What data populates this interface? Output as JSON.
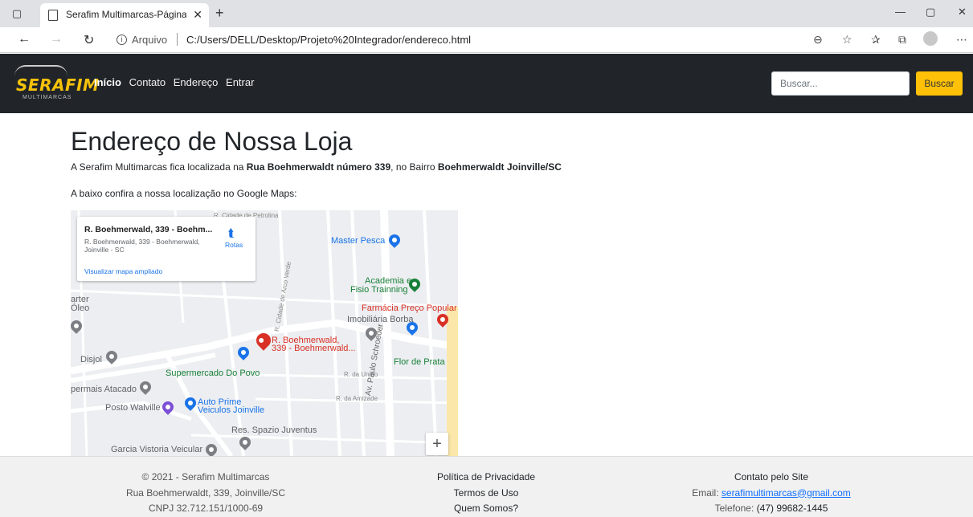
{
  "browser": {
    "tab_title": "Serafim Multimarcas-Página Inici",
    "address_label": "Arquivo",
    "url": "C:/Users/DELL/Desktop/Projeto%20Integrador/endereco.html"
  },
  "navbar": {
    "logo_text": "SERAFIM",
    "logo_subtext": "MULTIMARCAS",
    "links": [
      "Início",
      "Contato",
      "Endereço",
      "Entrar"
    ],
    "search_placeholder": "Buscar...",
    "search_button": "Buscar"
  },
  "main": {
    "title": "Endereço de Nossa Loja",
    "intro_prefix": "A Serafim Multimarcas fica localizada na ",
    "intro_street": "Rua Boehmerwaldt número 339",
    "intro_middle": ", no Bairro ",
    "intro_district": "Boehmerwaldt Joinville/SC",
    "map_intro": "A baixo confira a nossa localização no Google Maps:"
  },
  "map": {
    "card_title": "R. Boehmerwald, 339 - Boehm...",
    "card_address": "R. Boehmerwald, 339 - Boehmerwald, Joinville - SC",
    "card_directions": "Rotas",
    "card_link": "Visualizar mapa ampliado",
    "marker_label_1": "R. Boehmerwald,",
    "marker_label_2": "339 - Boehmerwald...",
    "places": {
      "master_pesca": "Master Pesca",
      "academia_1": "Academia e",
      "academia_2": "Fisio Trainning",
      "farmacia": "Farmácia Preço Popular",
      "imobiliaria": "Imobiliária Borba",
      "flor_prata": "Flor de Prata",
      "supermercado": "Supermercado Do Povo",
      "disjol": "Disjol",
      "atacado": "permais Atacado",
      "auto_prime_1": "Auto Prime",
      "auto_prime_2": "Veiculos Joinville",
      "posto": "Posto Walville",
      "spazio": "Res. Spazio Juventus",
      "garcia": "Garcia Vistoria Veicular",
      "arter_1": "arter",
      "arter_2": "Óleo"
    },
    "streets": {
      "cidade_petrolina": "R. Cidade de Petrolina",
      "da_uniao": "R. da União",
      "da_amizade": "R. da Amizade",
      "paulo_schroeder": "Av. Paulo Schroeder",
      "cidade_arco_verde": "R. Cidade de Arco Verde"
    },
    "zoom_in": "+"
  },
  "footer": {
    "col1": [
      "© 2021 - Serafim Multimarcas",
      "Rua Boehmerwaldt, 339, Joinville/SC",
      "CNPJ 32.712.151/1000-69"
    ],
    "col2": [
      "Política de Privacidade",
      "Termos de Uso",
      "Quem Somos?"
    ],
    "col3_title": "Contato pelo Site",
    "col3_email_label": "Email: ",
    "col3_email": "serafimultimarcas@gmail.com",
    "col3_phone_label": "Telefone: ",
    "col3_phone": "(47) 99682-1445"
  },
  "colors": {
    "navbar_bg": "#212529",
    "accent_yellow": "#ffc107",
    "logo_yellow": "#f5c20a",
    "link_blue": "#0d6efd",
    "footer_bg": "#f1f1f1",
    "map_marker": "#d93025"
  },
  "icons": {
    "sidebar": "sidebar-toggle-icon",
    "page": "page-icon",
    "back": "back-arrow-icon",
    "forward": "forward-arrow-icon",
    "refresh": "refresh-icon",
    "zoom": "zoom-icon",
    "favorite_add": "favorite-add-icon",
    "favorites": "favorites-icon",
    "collections": "collections-icon",
    "profile": "profile-avatar",
    "more": "more-icon",
    "directions": "directions-icon"
  }
}
